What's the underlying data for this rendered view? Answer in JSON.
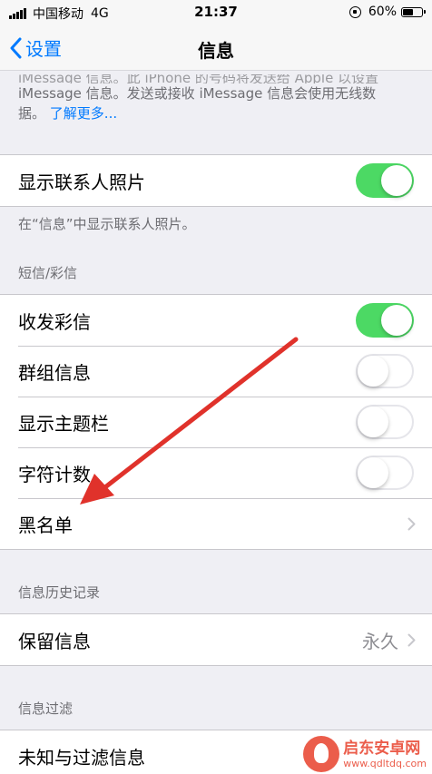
{
  "status_bar": {
    "carrier": "中国移动",
    "network": "4G",
    "time": "21:37",
    "battery_percent_label": "60%",
    "battery_level": 0.6
  },
  "nav": {
    "back_label": "设置",
    "title": "信息"
  },
  "intro": {
    "line_faded": "iMessage 信息。此 iPhone 的号码将发送给 Apple 以设置",
    "line1": "iMessage 信息。发送或接收 iMessage 信息会使用无线数",
    "line2": "据。",
    "link": "了解更多..."
  },
  "contact_photos": {
    "label": "显示联系人照片",
    "enabled": true,
    "footer": "在“信息”中显示联系人照片。"
  },
  "sms_mms": {
    "header": "短信/彩信",
    "rows": [
      {
        "label": "收发彩信",
        "enabled": true
      },
      {
        "label": "群组信息",
        "enabled": false
      },
      {
        "label": "显示主题栏",
        "enabled": false
      },
      {
        "label": "字符计数",
        "enabled": false
      }
    ],
    "blacklist_label": "黑名单"
  },
  "history": {
    "header": "信息历史记录",
    "keep_label": "保留信息",
    "keep_value": "永久"
  },
  "filtering": {
    "header": "信息过滤",
    "unknown_label": "未知与过滤信息"
  },
  "watermark": {
    "name": "启东安卓网",
    "url": "www.qdltdq.com"
  },
  "colors": {
    "accent": "#007aff",
    "toggle_on": "#4cd964",
    "annotation_arrow": "#e0322b"
  }
}
